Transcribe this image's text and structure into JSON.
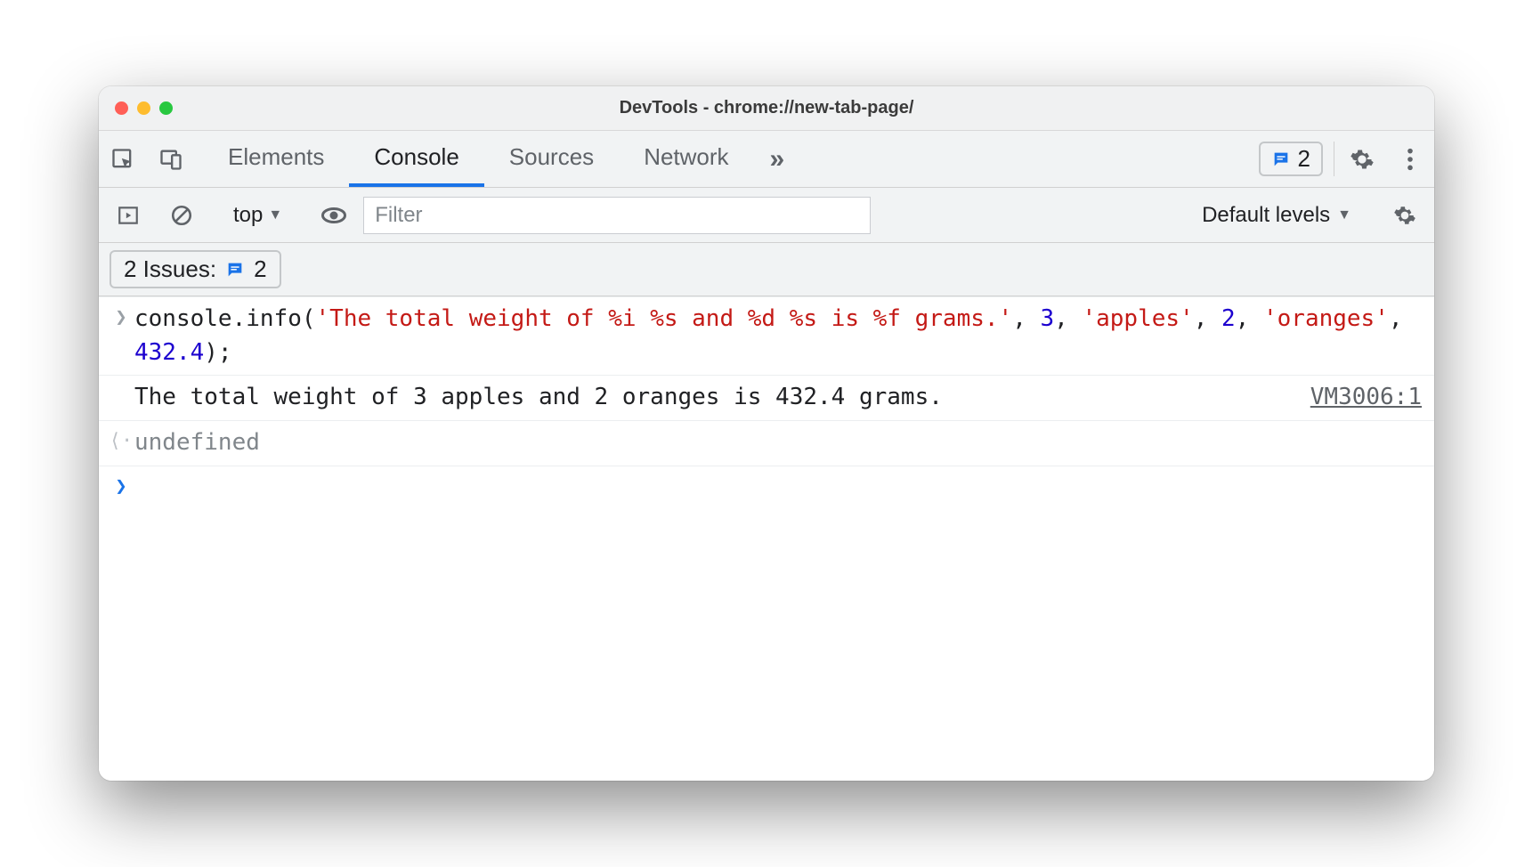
{
  "window": {
    "title": "DevTools - chrome://new-tab-page/"
  },
  "tabs": {
    "items": [
      "Elements",
      "Console",
      "Sources",
      "Network"
    ],
    "active_index": 1,
    "issues_count": "2"
  },
  "toolbar": {
    "context": "top",
    "filter_placeholder": "Filter",
    "levels_label": "Default levels"
  },
  "issues_bar": {
    "label": "2 Issues:",
    "count": "2"
  },
  "console": {
    "input": {
      "tokens": [
        {
          "t": "obj",
          "v": "console"
        },
        {
          "t": "punc",
          "v": "."
        },
        {
          "t": "obj",
          "v": "info"
        },
        {
          "t": "punc",
          "v": "("
        },
        {
          "t": "str",
          "v": "'The total weight of %i %s and %d %s is %f grams.'"
        },
        {
          "t": "punc",
          "v": ", "
        },
        {
          "t": "num",
          "v": "3"
        },
        {
          "t": "punc",
          "v": ", "
        },
        {
          "t": "str",
          "v": "'apples'"
        },
        {
          "t": "punc",
          "v": ", "
        },
        {
          "t": "num",
          "v": "2"
        },
        {
          "t": "punc",
          "v": ", "
        },
        {
          "t": "str",
          "v": "'oranges'"
        },
        {
          "t": "punc",
          "v": ", "
        },
        {
          "t": "num",
          "v": "432.4"
        },
        {
          "t": "punc",
          "v": ");"
        }
      ]
    },
    "output": {
      "text": "The total weight of 3 apples and 2 oranges is 432.4 grams.",
      "source": "VM3006:1"
    },
    "return_value": "undefined"
  }
}
